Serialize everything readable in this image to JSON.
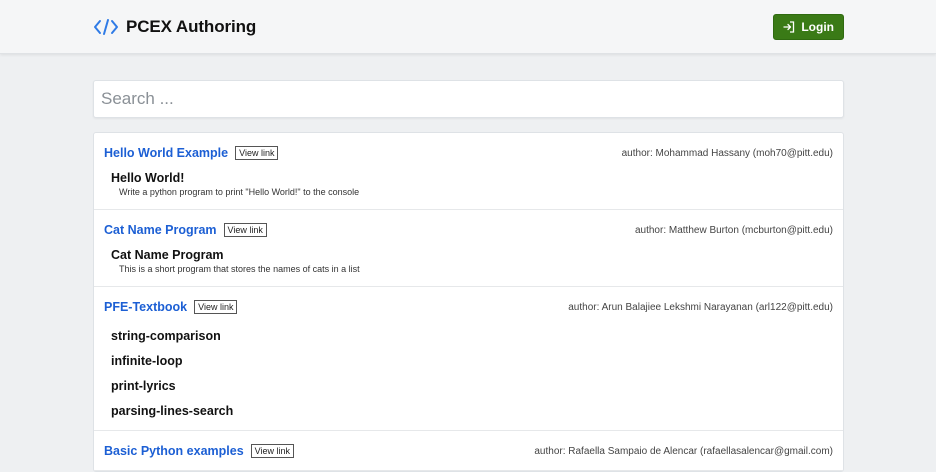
{
  "header": {
    "brand_title": "PCEX Authoring",
    "login_label": "Login",
    "accent_color": "#3a7a16",
    "brand_icon": "code-brackets-icon"
  },
  "search": {
    "placeholder": "Search ..."
  },
  "items": [
    {
      "title": "Hello World Example",
      "view_link": "View link",
      "author": "author: Mohammad Hassany (moh70@pitt.edu)",
      "activities": [
        {
          "title": "Hello World!",
          "desc": "Write a python program to print \"Hello World!\" to the console"
        }
      ]
    },
    {
      "title": "Cat Name Program",
      "view_link": "View link",
      "author": "author: Matthew Burton (mcburton@pitt.edu)",
      "activities": [
        {
          "title": "Cat Name Program",
          "desc": "This is a short program that stores the names of cats in a list"
        }
      ]
    },
    {
      "title": "PFE-Textbook",
      "view_link": "View link",
      "author": "author: Arun Balajiee Lekshmi Narayanan (arl122@pitt.edu)",
      "activities": [
        {
          "title": "string-comparison"
        },
        {
          "title": "infinite-loop"
        },
        {
          "title": "print-lyrics"
        },
        {
          "title": "parsing-lines-search"
        }
      ]
    },
    {
      "title": "Basic Python examples",
      "view_link": "View link",
      "author": "author: Rafaella Sampaio de Alencar (rafaellasalencar@gmail.com)"
    }
  ]
}
